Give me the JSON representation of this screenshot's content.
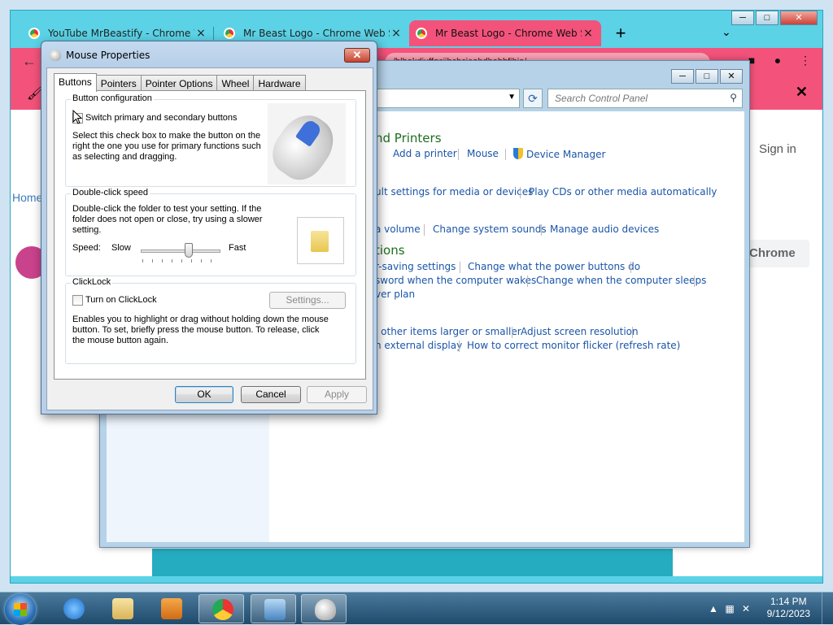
{
  "chrome": {
    "tabs": [
      {
        "title": "YouTube MrBeastify - Chrome W",
        "close": "×"
      },
      {
        "title": "Mr Beast Logo - Chrome Web St",
        "close": "×"
      },
      {
        "title": "Mr Beast Logo - Chrome Web St",
        "close": "×"
      }
    ],
    "new_tab": "+",
    "tab_dropdown": "⌄",
    "url_fragment": "/blbakdiuffgcijbchcjeahdhabbfibjo/",
    "window_buttons": {
      "minimize": "─",
      "maximize": "□",
      "close": "✕"
    },
    "page": {
      "home_label": "Home",
      "signin_label": "Sign in",
      "add_button_label": "Chrome"
    },
    "infobar_close": "✕"
  },
  "control_panel": {
    "search_placeholder": "Search Control Panel",
    "window_buttons": {
      "minimize": "─",
      "maximize": "□",
      "close": "✕"
    },
    "section_heading_1": "nd Printers",
    "section_heading_2": "tions",
    "links": {
      "add_printer": "Add a printer",
      "mouse": "Mouse",
      "device_manager": "Device Manager",
      "default_settings": "ult settings for media or devices",
      "play_cds": "Play CDs or other media automatically",
      "volume": "a volume",
      "change_sounds": "Change system sounds",
      "manage_audio": "Manage audio devices",
      "power_saving": "r-saving settings",
      "power_buttons": "Change what the power buttons do",
      "password_wake": "sword when the computer wakes",
      "sleep": "Change when the computer sleeps",
      "power_plan": "ver plan",
      "items_larger": "l other items larger or smaller",
      "resolution": "Adjust screen resolution",
      "external_display": "n external display",
      "flicker": "How to correct monitor flicker (refresh rate)"
    }
  },
  "dialog": {
    "title": "Mouse Properties",
    "close": "✕",
    "tabs": [
      "Buttons",
      "Pointers",
      "Pointer Options",
      "Wheel",
      "Hardware"
    ],
    "active_tab": "Buttons",
    "button_config": {
      "legend": "Button configuration",
      "checkbox_label": "Switch primary and secondary buttons",
      "checked": false,
      "description": "Select this check box to make the button on the right the one you use for primary functions such as selecting and dragging."
    },
    "double_click": {
      "legend": "Double-click speed",
      "description": "Double-click the folder to test your setting. If the folder does not open or close, try using a slower setting.",
      "speed_label": "Speed:",
      "slow_label": "Slow",
      "fast_label": "Fast",
      "speed_level": 0.6
    },
    "clicklock": {
      "legend": "ClickLock",
      "checkbox_label": "Turn on ClickLock",
      "checked": false,
      "settings_button": "Settings...",
      "description": "Enables you to highlight or drag without holding down the mouse button. To set, briefly press the mouse button. To release, click the mouse button again."
    },
    "buttons": {
      "ok": "OK",
      "cancel": "Cancel",
      "apply": "Apply"
    }
  },
  "taskbar": {
    "time": "1:14 PM",
    "date": "9/12/2023"
  }
}
